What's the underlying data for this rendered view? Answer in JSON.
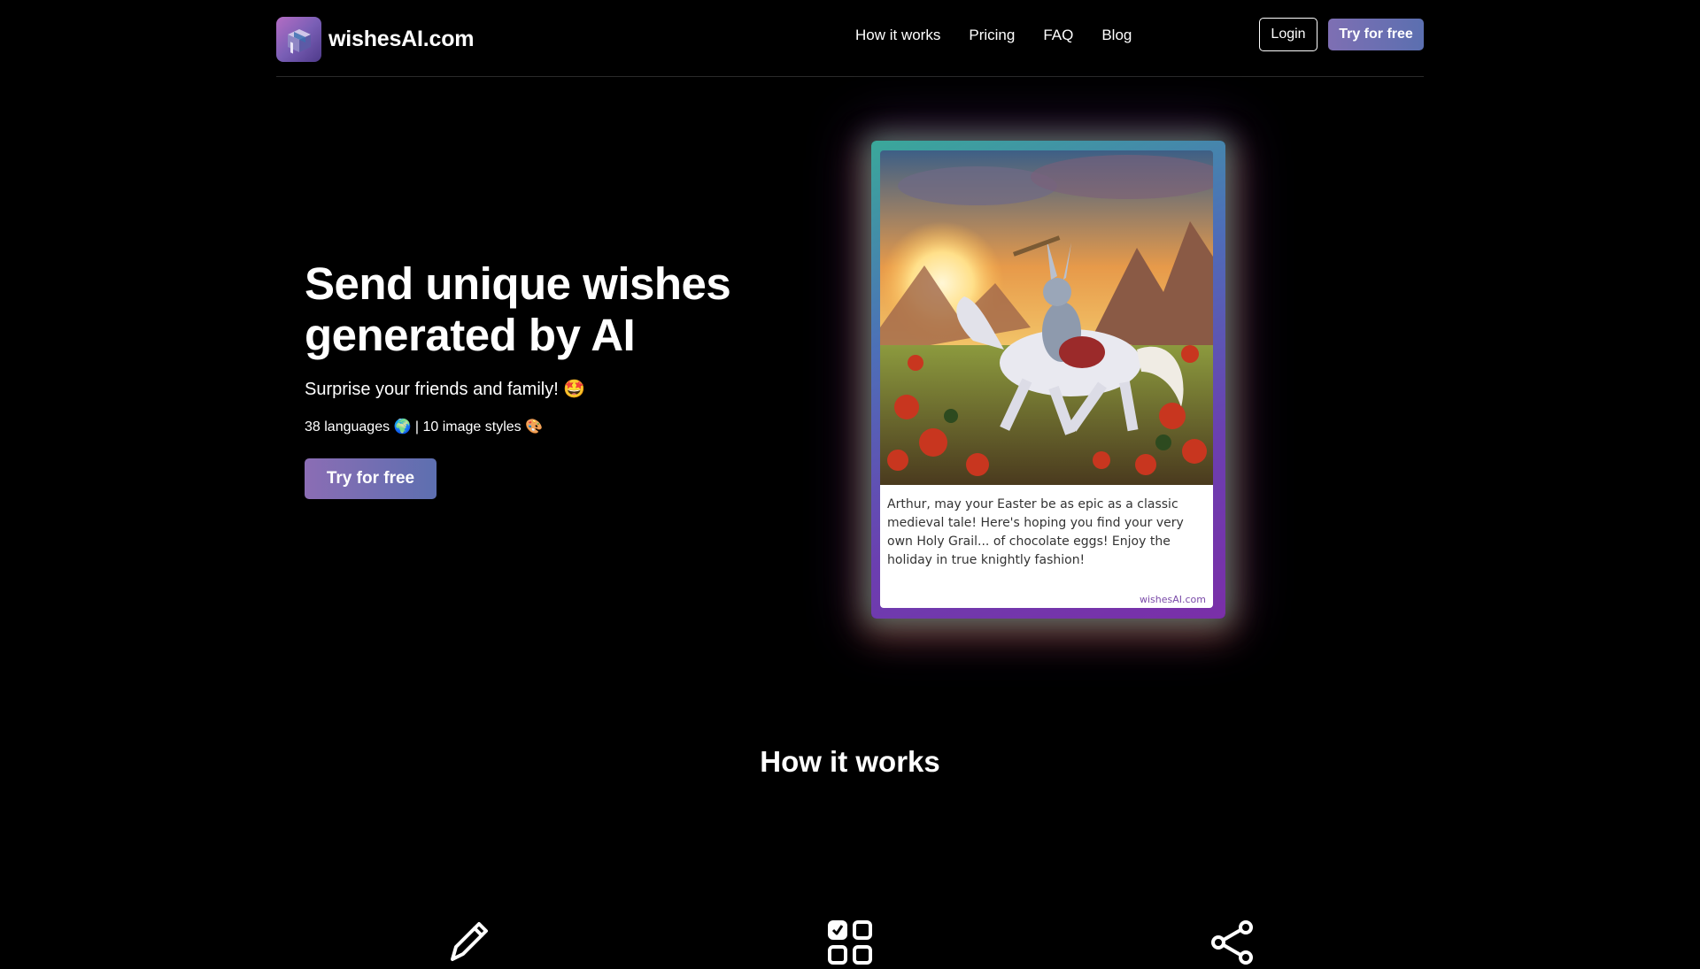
{
  "header": {
    "brand_name": "wishesAI.com",
    "nav": [
      {
        "label": "How it works"
      },
      {
        "label": "Pricing"
      },
      {
        "label": "FAQ"
      },
      {
        "label": "Blog"
      }
    ],
    "login_label": "Login",
    "try_label": "Try for free"
  },
  "hero": {
    "title": "Send unique wishes generated by AI",
    "subtitle": "Surprise your friends and family! 🤩",
    "meta": "38 languages 🌍 | 10 image styles 🎨",
    "cta_label": "Try for free"
  },
  "card": {
    "message": "Arthur, may your Easter be as epic as a classic medieval tale! Here's hoping you find your very own Holy Grail... of chocolate eggs! Enjoy the holiday in true knightly fashion!",
    "watermark": "wishesAI.com"
  },
  "how_it_works": {
    "title": "How it works",
    "steps": [
      {
        "icon": "pencil-icon"
      },
      {
        "icon": "checklist-grid-icon"
      },
      {
        "icon": "share-icon"
      }
    ]
  },
  "colors": {
    "background": "#000000",
    "accent_gradient_start": "#8b6db4",
    "accent_gradient_end": "#5d6fb0",
    "text": "#ffffff"
  }
}
